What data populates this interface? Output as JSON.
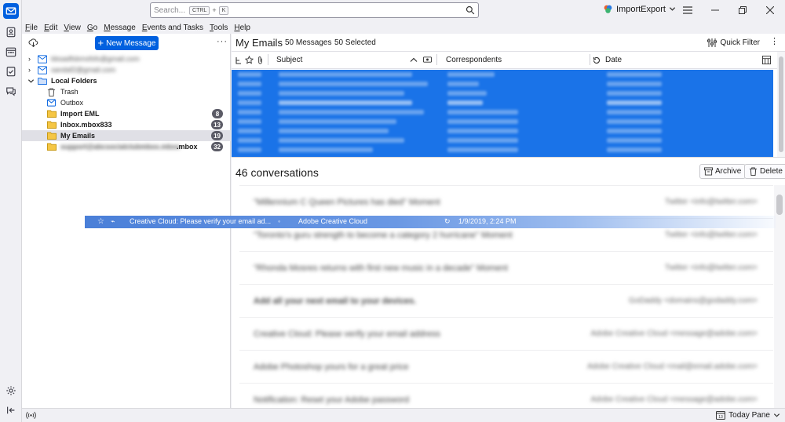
{
  "titlebar": {
    "search_placeholder": "Search...",
    "kbd1": "CTRL",
    "kbd_plus": "+",
    "kbd2": "K",
    "profile": "ImportExport"
  },
  "menu": [
    "File",
    "Edit",
    "View",
    "Go",
    "Message",
    "Events and Tasks",
    "Tools",
    "Help"
  ],
  "folderpane": {
    "new_message": "New Message",
    "accounts": [
      "bbsadfsbmsfsfs@gmail.com",
      "sandaf2@gmail.com"
    ],
    "local_folders": "Local Folders",
    "folders": [
      {
        "label": "Trash",
        "badge": ""
      },
      {
        "label": "Outbox",
        "badge": ""
      },
      {
        "label": "Import EML",
        "badge": "8"
      },
      {
        "label": "Inbox.mbox833",
        "badge": "13"
      },
      {
        "label": "My Emails",
        "badge": "19"
      },
      {
        "label": "support@abcsocialclubmbox.mbox",
        "badge": "32"
      }
    ],
    "last_folder_suffix": ".mbox"
  },
  "list": {
    "title": "My Emails",
    "count": "50 Messages",
    "selected": "50 Selected",
    "quick_filter": "Quick Filter",
    "col_subject": "Subject",
    "col_correspondents": "Correspondents",
    "col_date": "Date"
  },
  "summary": {
    "conversations": "46 conversations",
    "archive": "Archive",
    "delete": "Delete",
    "rows": [
      {
        "subject": "\"Millennium C Queen Pictures has died\" Moment",
        "from": "Twitter <info@twitter.com>"
      },
      {
        "subject": "\"Toronto's guru strength to become a category 2 hurricane\" Moment",
        "from": "Twitter <info@twitter.com>"
      },
      {
        "subject": "\"Rhonda Mosres returns with first new music in a decade\" Moment",
        "from": "Twitter <info@twitter.com>"
      },
      {
        "subject": "Add all your next email to your devices.",
        "from": "GoDaddy <domains@godaddy.com>"
      },
      {
        "subject": "Creative Cloud: Please verify your email address",
        "from": "Adobe Creative Cloud <message@adobe.com>"
      },
      {
        "subject": "Adobe Photoshop yours for a great price",
        "from": "Adobe Creative Cloud <mail@email.adobe.com>"
      },
      {
        "subject": "Notification: Reset your Adobe password",
        "from": "Adobe Creative Cloud <message@adobe.com>"
      }
    ]
  },
  "drag": {
    "subject": "Creative Cloud: Please verify your email ad...",
    "from": "Adobe Creative Cloud",
    "date": "1/9/2019, 2:24 PM"
  },
  "statusbar": {
    "today_pane": "Today Pane"
  }
}
